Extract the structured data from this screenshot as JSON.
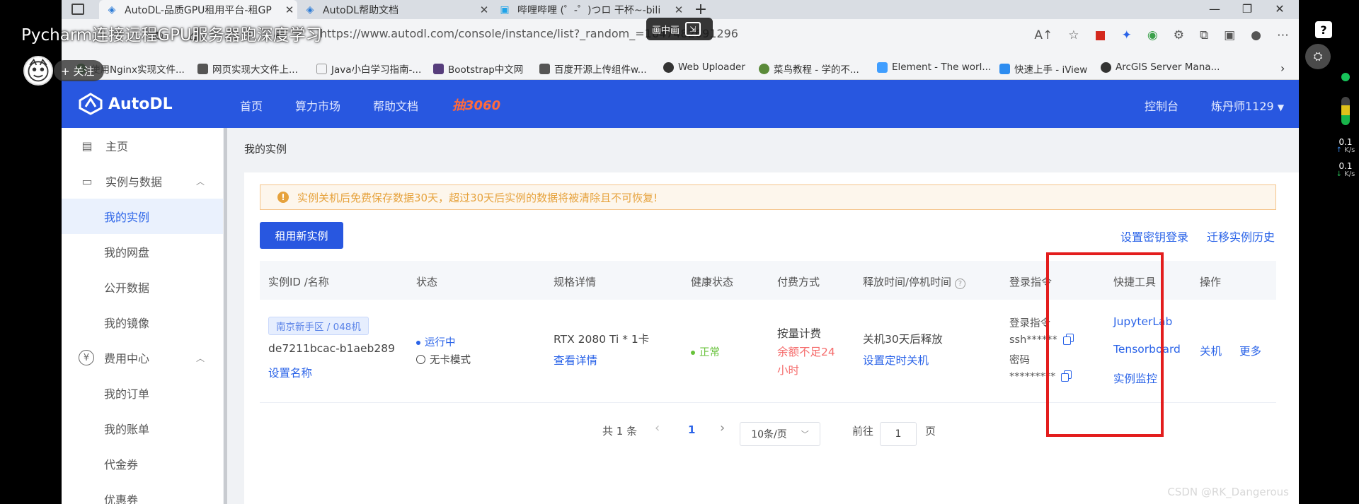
{
  "overlay": {
    "video_title": "Pycharm连接远程GPU服务器跑深度学习",
    "follow_label": "+ 关注",
    "pip_label": "画中画",
    "watermark": "CSDN @RK_Dangerous"
  },
  "side_panel": {
    "help_icon": "?",
    "speed_up": "0.1",
    "speed_down": "0.1",
    "speed_unit": "K/s"
  },
  "browser": {
    "tabs": [
      {
        "label": "AutoDL-品质GPU租用平台-租GP",
        "active": true
      },
      {
        "label": "AutoDL帮助文档",
        "active": false
      },
      {
        "label": "哔哩哔哩 (゜-゜)つロ 干杯~-bili",
        "active": false
      }
    ],
    "new_tab": "+",
    "url": "https://www.autodl.com/console/instance/list?_random_=1647482691296",
    "bookmarks": [
      "使用Nginx实现文件...",
      "网页实现大文件上...",
      "Java小白学习指南-...",
      "Bootstrap中文网",
      "百度开源上传组件w...",
      "Web Uploader",
      "菜鸟教程 - 学的不...",
      "Element - The worl...",
      "快速上手 - iView",
      "ArcGIS Server Mana..."
    ]
  },
  "header": {
    "logo_text": "AutoDL",
    "nav": [
      "首页",
      "算力市场",
      "帮助文档"
    ],
    "promo": "抽3060",
    "console": "控制台",
    "user": "炼丹师1129"
  },
  "sidebar": {
    "home": "主页",
    "instances_group": "实例与数据",
    "my_instances": "我的实例",
    "my_netdisk": "我的网盘",
    "public_data": "公开数据",
    "my_images": "我的镜像",
    "billing_group": "费用中心",
    "my_orders": "我的订单",
    "my_bills": "我的账单",
    "vouchers": "代金券",
    "coupons": "优惠券"
  },
  "main": {
    "breadcrumb": "我的实例",
    "alert": "实例关机后免费保存数据30天，超过30天后实例的数据将被清除且不可恢复!",
    "rent_button": "租用新实例",
    "set_key_login": "设置密钥登录",
    "migrate_history": "迁移实例历史",
    "columns": [
      "实例ID /名称",
      "状态",
      "规格详情",
      "健康状态",
      "付费方式",
      "释放时间/停机时间",
      "登录指令",
      "快捷工具",
      "操作"
    ],
    "row": {
      "region": "南京新手区 / 048机",
      "instance_id": "de7211bcac-b1aeb289",
      "set_name": "设置名称",
      "status_running": "运行中",
      "status_nocard": "无卡模式",
      "spec": "RTX 2080 Ti * 1卡",
      "spec_detail": "查看详情",
      "health": "正常",
      "billing": "按量计费",
      "balance_warning_1": "余额不足24",
      "balance_warning_2": "小时",
      "release": "关机30天后释放",
      "set_timer": "设置定时关机",
      "login_label": "登录指令",
      "ssh_masked": "ssh******",
      "password_label": "密码",
      "password_masked": "*********",
      "tool_jupyter": "JupyterLab",
      "tool_tensorboard": "Tensorboard",
      "tool_monitor": "实例监控",
      "op_shutdown": "关机",
      "op_more": "更多"
    },
    "pagination": {
      "total": "共 1 条",
      "prev": "‹",
      "current_page": "1",
      "next": "›",
      "page_size": "10条/页",
      "goto_label": "前往",
      "goto_value": "1",
      "page_suffix": "页"
    }
  },
  "colors": {
    "brand": "#2857e0",
    "link": "#2a63e8",
    "warning": "#e6a23c",
    "danger": "#f56c6c",
    "success": "#67c23a",
    "highlight_box": "#e31d1d"
  }
}
